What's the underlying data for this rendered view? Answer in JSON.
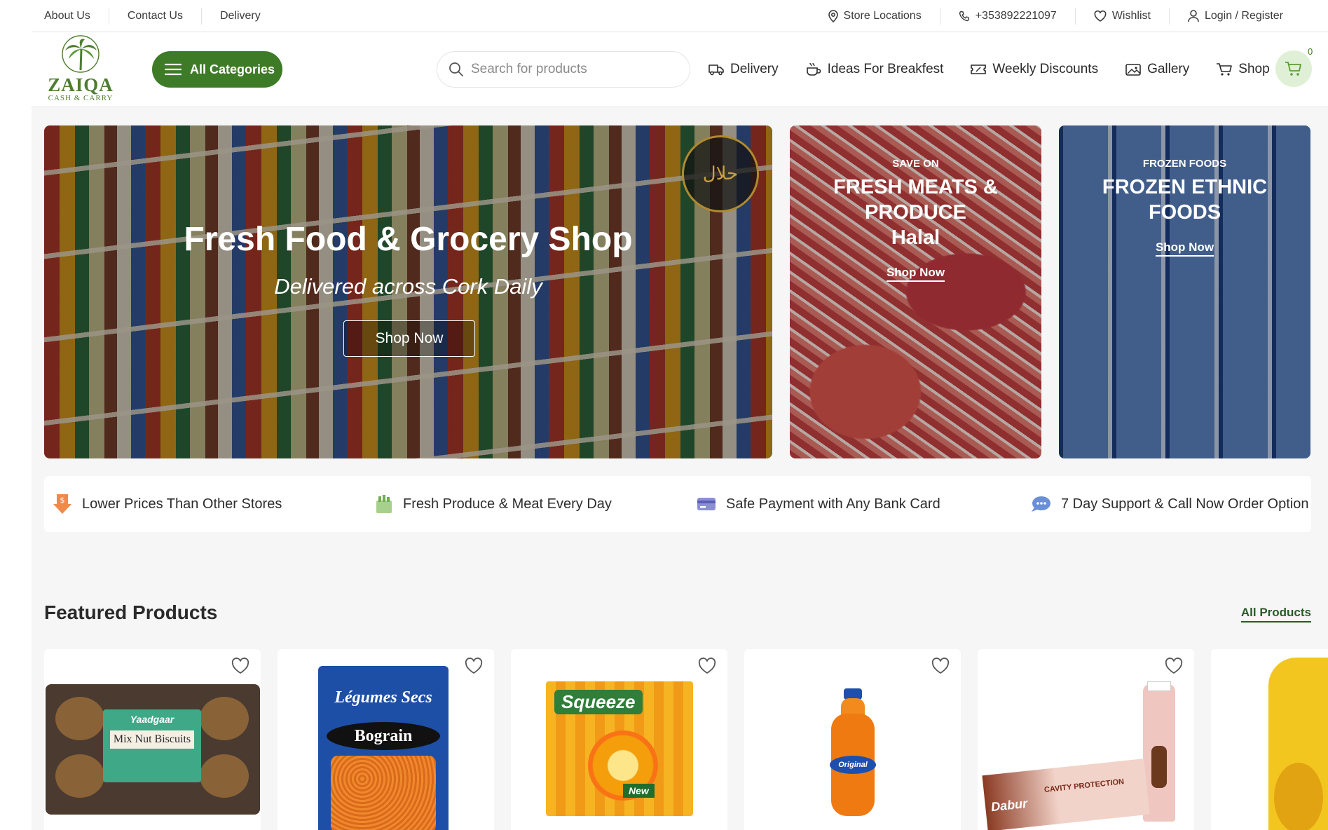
{
  "topbar": {
    "links": [
      "About Us",
      "Contact Us",
      "Delivery"
    ],
    "store_locations": "Store Locations",
    "phone": "+353892221097",
    "wishlist": "Wishlist",
    "login": "Login / Register"
  },
  "header": {
    "logo_text": "ZAIQA",
    "logo_sub": "CASH & CARRY",
    "categories_label": "All Categories",
    "search_placeholder": "Search for products",
    "nav": [
      "Delivery",
      "Ideas For Breakfest",
      "Weekly Discounts",
      "Gallery",
      "Shop"
    ],
    "cart_count": "0"
  },
  "hero": {
    "title": "Fresh Food & Grocery Shop",
    "subtitle": "Delivered across Cork Daily",
    "button": "Shop Now",
    "seal_text": "حلال"
  },
  "promo_cards": [
    {
      "kicker": "SAVE ON",
      "line1": "FRESH MEATS &",
      "line2": "PRODUCE",
      "line3": "Halal",
      "link": "Shop Now"
    },
    {
      "kicker": "FROZEN FOODS",
      "line1": "FROZEN ETHNIC",
      "line2": "FOODS",
      "link": "Shop Now"
    }
  ],
  "features": [
    "Lower Prices Than Other Stores",
    "Fresh Produce & Meat Every Day",
    "Safe Payment with Any Bank Card",
    "7 Day Support & Call Now Order Option"
  ],
  "featured": {
    "title": "Featured Products",
    "all_link": "All Products",
    "product_labels": [
      "Yaadgaar",
      "Mix Nut Biscuits",
      "Légumes Secs",
      "Bograin",
      "Squeeze",
      "New",
      "Original",
      "Dabur",
      "CAVITY PROTECTION"
    ]
  },
  "colors": {
    "brand_green": "#3e7b27",
    "cart_bg": "#dff0d6",
    "accent_orange": "#f08a4b"
  }
}
